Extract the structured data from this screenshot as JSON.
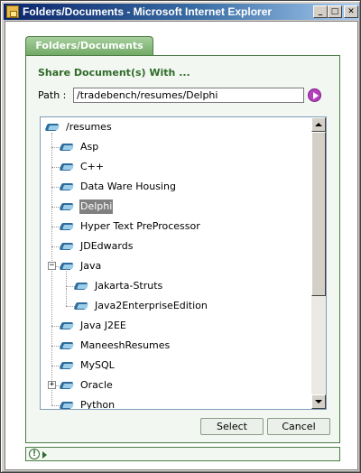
{
  "window": {
    "title": "Folders/Documents - Microsoft Internet Explorer",
    "minimize_glyph": "_",
    "maximize_glyph": "□",
    "close_glyph": "✕"
  },
  "tab": {
    "label": "Folders/Documents"
  },
  "share": {
    "heading": "Share Document(s) With ..."
  },
  "path": {
    "label": "Path :",
    "value": "/tradebench/resumes/Delphi"
  },
  "tree": {
    "root": "/resumes",
    "items": [
      {
        "label": "Asp"
      },
      {
        "label": "C++"
      },
      {
        "label": "Data Ware Housing"
      },
      {
        "label": "Delphi",
        "selected": true
      },
      {
        "label": "Hyper Text PreProcessor"
      },
      {
        "label": "JDEdwards"
      },
      {
        "label": "Java",
        "expanded": true,
        "toggle": "−"
      },
      {
        "label": "Jakarta-Struts",
        "child": true
      },
      {
        "label": "Java2EnterpriseEdition",
        "child": true
      },
      {
        "label": "Java J2EE"
      },
      {
        "label": "ManeeshResumes"
      },
      {
        "label": "MySQL"
      },
      {
        "label": "Oracle",
        "expanded": false,
        "toggle": "+"
      },
      {
        "label": "Python"
      }
    ]
  },
  "buttons": {
    "select_label": "Select",
    "cancel_label": "Cancel"
  },
  "status": {
    "icon_glyph": "!"
  },
  "colors": {
    "accent_green": "#4c7d46",
    "heading_green": "#2f6b2a",
    "title_blue": "#0a246a"
  }
}
